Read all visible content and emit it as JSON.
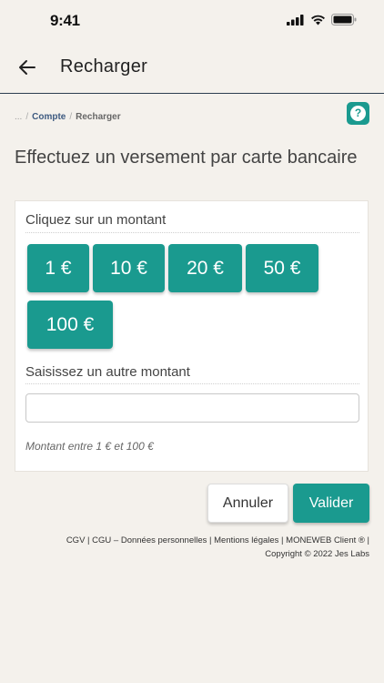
{
  "status_bar": {
    "time": "9:41"
  },
  "header": {
    "title": "Recharger"
  },
  "breadcrumb": {
    "ellipsis": "...",
    "items": [
      "Compte",
      "Recharger"
    ]
  },
  "main": {
    "title": "Effectuez un versement par carte bancaire",
    "amount_section_label": "Cliquez sur un montant",
    "amounts": [
      "1 €",
      "10 €",
      "20 €",
      "50 €",
      "100 €"
    ],
    "other_amount_label": "Saisissez un autre montant",
    "other_amount_value": "",
    "hint": "Montant entre 1 € et 100 €"
  },
  "actions": {
    "cancel": "Annuler",
    "validate": "Valider"
  },
  "footer": {
    "links": [
      "CGV",
      "CGU – Données personnelles",
      "Mentions légales",
      "MONEWEB Client ®"
    ],
    "copyright": "Copyright © 2022 Jes Labs"
  },
  "colors": {
    "accent": "#1a9a8f",
    "background": "#f4f1ec",
    "link": "#3d5a80"
  }
}
